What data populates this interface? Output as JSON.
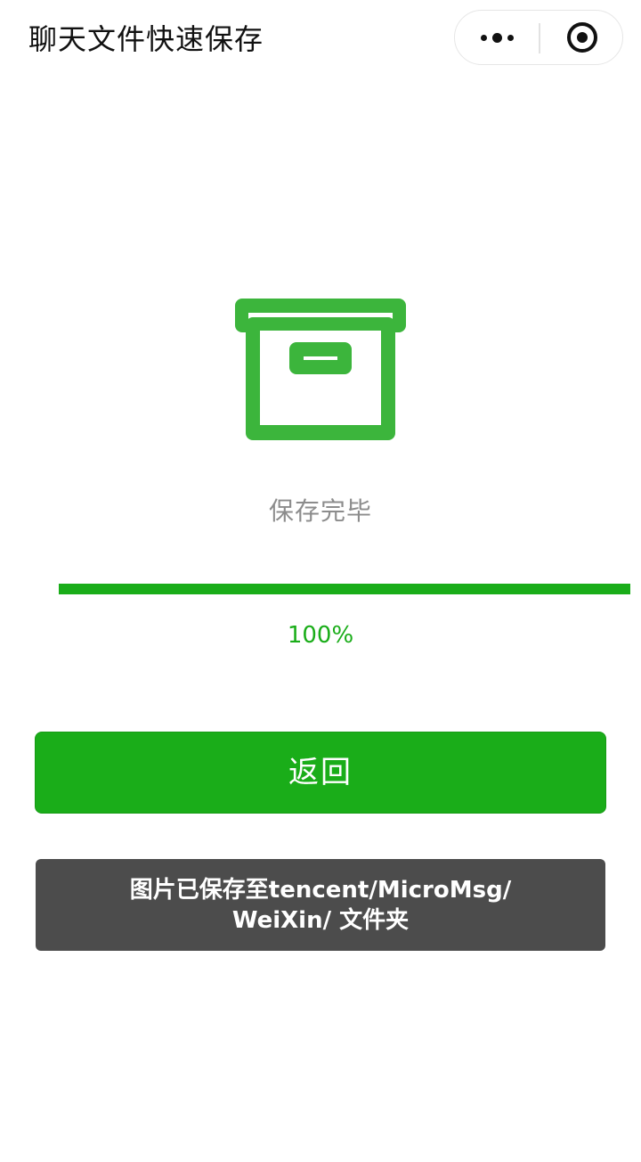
{
  "header": {
    "title": "聊天文件快速保存",
    "more_icon": "more-dots-icon",
    "close_icon": "target-close-icon"
  },
  "main": {
    "icon": "archive-box-icon",
    "icon_color": "#3cb53c",
    "status_text": "保存完毕",
    "progress_fraction": 1.0,
    "progress_label": "100%",
    "accent_color": "#1aad19"
  },
  "actions": {
    "back_label": "返回"
  },
  "toast": {
    "line1": "图片已保存至tencent/MicroMsg/",
    "line2": "WeiXin/ 文件夹"
  }
}
